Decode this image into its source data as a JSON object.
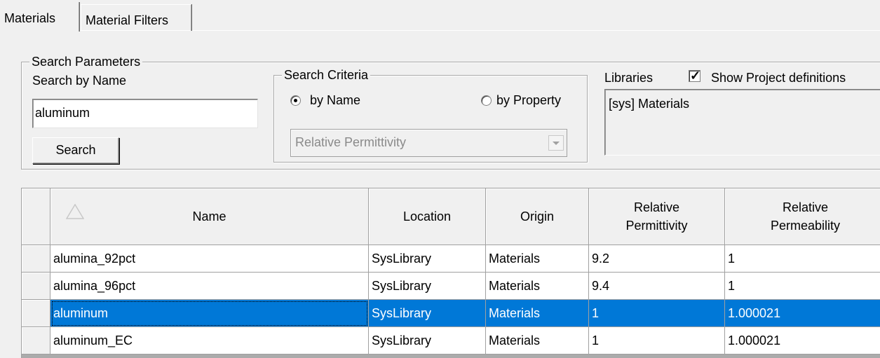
{
  "tabs": [
    {
      "label": "Materials",
      "active": true
    },
    {
      "label": "Material Filters",
      "active": false
    }
  ],
  "search_parameters": {
    "legend": "Search Parameters",
    "search_by_name_label": "Search by Name",
    "search_value": "aluminum",
    "search_button": "Search"
  },
  "search_criteria": {
    "legend": "Search Criteria",
    "by_name_label": "by Name",
    "by_property_label": "by Property",
    "selected": "by Name",
    "property_dropdown_value": "Relative Permittivity"
  },
  "libraries": {
    "label": "Libraries",
    "show_project_definitions_label": "Show Project definitions",
    "show_project_definitions_checked": true,
    "items": [
      "[sys] Materials"
    ]
  },
  "grid": {
    "columns": [
      {
        "key": "name",
        "label": "Name"
      },
      {
        "key": "location",
        "label": "Location"
      },
      {
        "key": "origin",
        "label": "Origin"
      },
      {
        "key": "permittivity",
        "label_line1": "Relative",
        "label_line2": "Permittivity"
      },
      {
        "key": "permeability",
        "label_line1": "Relative",
        "label_line2": "Permeability"
      }
    ],
    "rows": [
      {
        "name": "alumina_92pct",
        "location": "SysLibrary",
        "origin": "Materials",
        "permittivity": "9.2",
        "permeability": "1",
        "selected": false
      },
      {
        "name": "alumina_96pct",
        "location": "SysLibrary",
        "origin": "Materials",
        "permittivity": "9.4",
        "permeability": "1",
        "selected": false
      },
      {
        "name": "aluminum",
        "location": "SysLibrary",
        "origin": "Materials",
        "permittivity": "1",
        "permeability": "1.000021",
        "selected": true
      },
      {
        "name": "aluminum_EC",
        "location": "SysLibrary",
        "origin": "Materials",
        "permittivity": "1",
        "permeability": "1.000021",
        "selected": false
      }
    ],
    "sort_icon": "sort-ascending-icon"
  },
  "colors": {
    "selection": "#0078d7",
    "window_bg": "#f0f0f0"
  }
}
